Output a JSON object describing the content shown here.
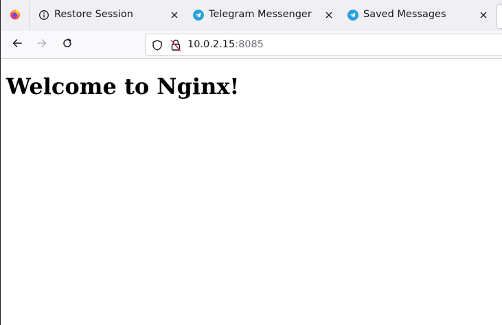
{
  "tabs": [
    {
      "label": "Restore Session",
      "icon": "info-icon"
    },
    {
      "label": "Telegram Messenger",
      "icon": "telegram-icon"
    },
    {
      "label": "Saved Messages",
      "icon": "telegram-icon"
    }
  ],
  "urlbar": {
    "host": "10.0.2.15",
    "port": ":8085"
  },
  "page": {
    "heading": "Welcome to Nginx!"
  },
  "colors": {
    "tabstrip_bg": "#f0f0f4",
    "navbar_bg": "#f9f9fb",
    "telegram_blue": "#2aa1da",
    "firefox_orange": "#ff7139"
  }
}
